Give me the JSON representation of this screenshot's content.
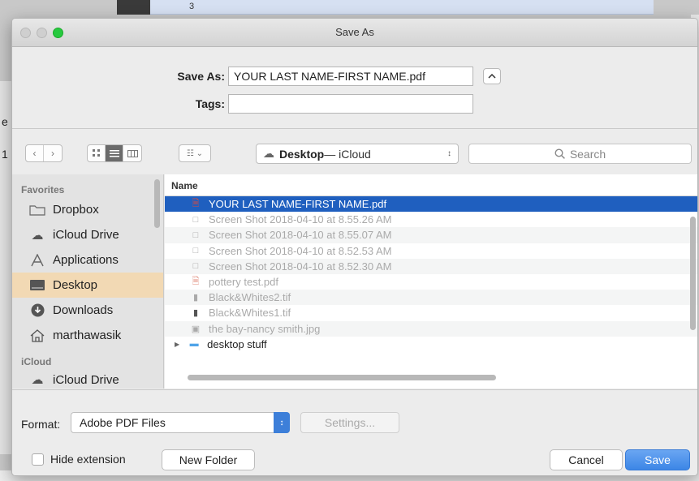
{
  "background": {
    "page_number": "3",
    "left_letter_1": "e",
    "left_letter_2": "1"
  },
  "window": {
    "title": "Save As"
  },
  "form": {
    "save_as_label": "Save As:",
    "save_as_value": "YOUR LAST NAME-FIRST NAME.pdf",
    "tags_label": "Tags:",
    "tags_value": ""
  },
  "toolbar": {
    "location": "Desktop",
    "location_suffix": " — iCloud",
    "search_placeholder": "Search"
  },
  "sidebar": {
    "favorites_header": "Favorites",
    "items": [
      {
        "label": "Dropbox",
        "icon": "folder-icon"
      },
      {
        "label": "iCloud Drive",
        "icon": "cloud-icon"
      },
      {
        "label": "Applications",
        "icon": "applications-icon"
      },
      {
        "label": "Desktop",
        "icon": "desktop-icon",
        "selected": true
      },
      {
        "label": "Downloads",
        "icon": "download-icon"
      },
      {
        "label": "marthawasik",
        "icon": "home-icon"
      }
    ],
    "icloud_header": "iCloud",
    "icloud_items": [
      {
        "label": "iCloud Drive",
        "icon": "cloud-icon"
      }
    ]
  },
  "filelist": {
    "column_name": "Name",
    "files": [
      {
        "name": "YOUR LAST NAME-FIRST NAME.pdf",
        "selected": true,
        "icon": "pdf-icon"
      },
      {
        "name": "Screen Shot 2018-04-10 at 8.55.26 AM",
        "icon": "image-icon"
      },
      {
        "name": "Screen Shot 2018-04-10 at 8.55.07 AM",
        "icon": "image-icon"
      },
      {
        "name": "Screen Shot 2018-04-10 at 8.52.53 AM",
        "icon": "image-icon"
      },
      {
        "name": "Screen Shot 2018-04-10 at 8.52.30 AM",
        "icon": "image-icon"
      },
      {
        "name": "pottery test.pdf",
        "icon": "pdf-icon"
      },
      {
        "name": "Black&Whites2.tif",
        "icon": "tif-icon"
      },
      {
        "name": "Black&Whites1.tif",
        "icon": "tif-icon"
      },
      {
        "name": "the bay-nancy smith.jpg",
        "icon": "jpg-icon"
      },
      {
        "name": "desktop stuff",
        "icon": "folder-icon"
      }
    ]
  },
  "bottom": {
    "format_label": "Format:",
    "format_value": "Adobe PDF Files",
    "settings_label": "Settings...",
    "hide_extension_label": "Hide extension",
    "new_folder_label": "New Folder",
    "cancel_label": "Cancel",
    "save_label": "Save"
  },
  "colors": {
    "accent": "#3c86e6",
    "selection": "#1f5fbf",
    "sidebar_selection": "#f2d9b4",
    "zoom_button": "#27c93f"
  }
}
